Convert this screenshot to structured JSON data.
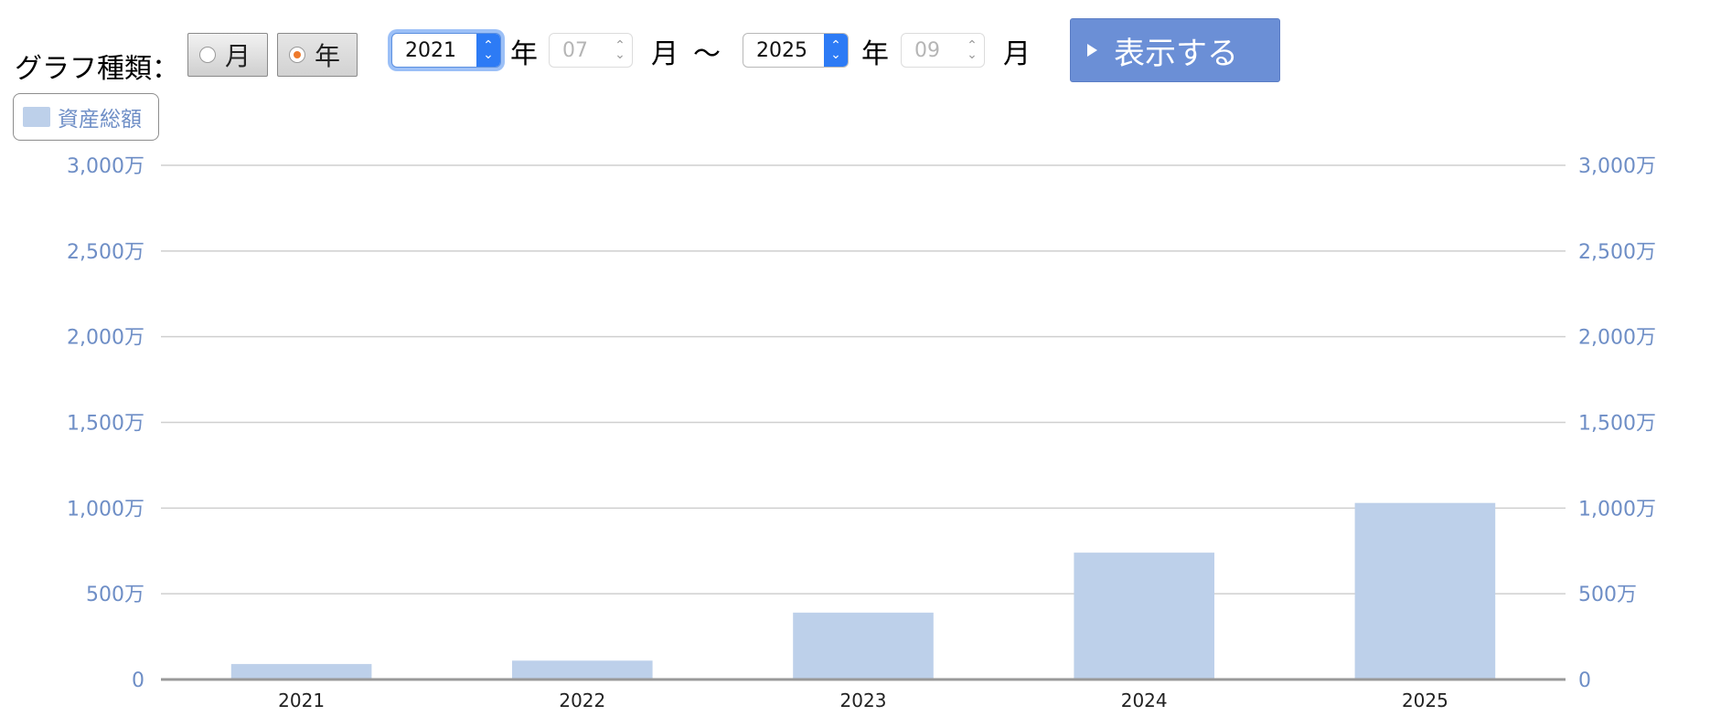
{
  "controls": {
    "type_label": "グラフ種類：",
    "radio_month": "月",
    "radio_year": "年",
    "selected_type": "year",
    "start_year": "2021",
    "start_month": "07",
    "end_year": "2025",
    "end_month": "09",
    "unit_year": "年",
    "unit_month": "月",
    "range_sep": "〜",
    "show_button": "表示する"
  },
  "legend": {
    "label": "資産総額"
  },
  "colors": {
    "bar": "#bdd0ea",
    "tick": "#6e8ec6",
    "button": "#6b8fd6",
    "grid": "#cfcfcf",
    "axis": "#999999"
  },
  "chart_data": {
    "type": "bar",
    "categories": [
      "2021",
      "2022",
      "2023",
      "2024",
      "2025"
    ],
    "series": [
      {
        "name": "資産総額",
        "values": [
          90,
          110,
          390,
          740,
          1030
        ]
      }
    ],
    "value_unit": "万",
    "ylim": [
      0,
      3000
    ],
    "yticks": [
      0,
      500,
      1000,
      1500,
      2000,
      2500,
      3000
    ],
    "ytick_labels": [
      "0",
      "500万",
      "1,000万",
      "1,500万",
      "2,000万",
      "2,500万",
      "3,000万"
    ],
    "grid": true,
    "dual_y_axis": true,
    "legend_position": "top-left"
  }
}
